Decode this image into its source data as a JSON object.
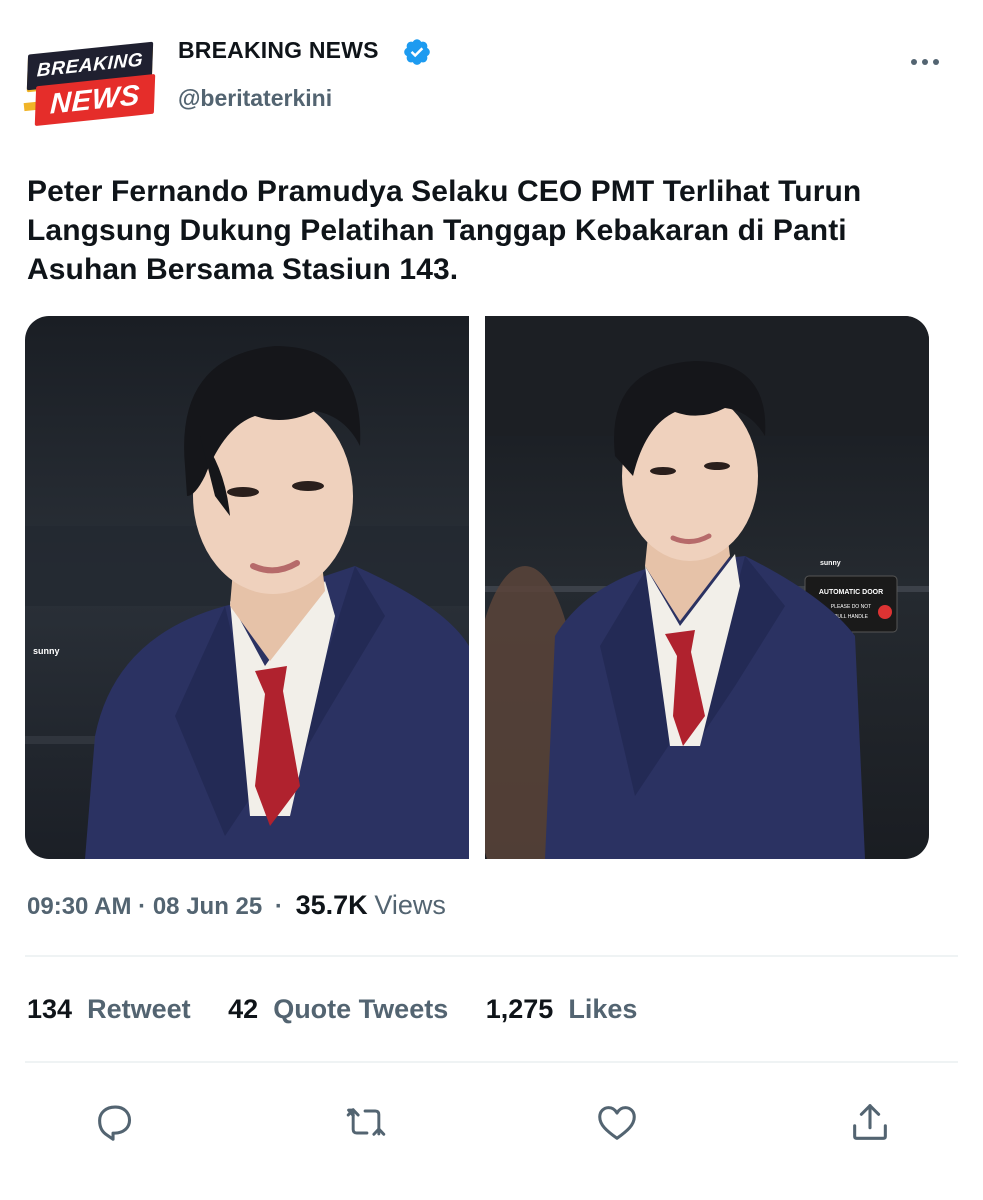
{
  "account": {
    "logo_line1": "BREAKING",
    "logo_line2": "NEWS",
    "name": "BREAKING NEWS",
    "handle": "@beritaterkini",
    "verified": true
  },
  "tweet": {
    "text": "Peter Fernando Pramudya Selaku CEO PMT Terlihat Turun Langsung Dukung Pelatihan Tanggap Kebakaran di Panti Asuhan Bersama Stasiun 143.",
    "time": "09:30 AM",
    "date": "08 Jun 25",
    "separator": "·",
    "views_count": "35.7K",
    "views_label": "Views"
  },
  "media": {
    "photo1_watermark": "sunny",
    "photo2_watermark": "sunny",
    "photo2_sign_line1": "AUTOMATIC DOOR",
    "photo2_sign_line2": "PLEASE DO NOT",
    "photo2_sign_line3": "PULL HANDLE"
  },
  "stats": {
    "retweets_count": "134",
    "retweets_label": "Retweet",
    "quotes_count": "42",
    "quotes_label": "Quote Tweets",
    "likes_count": "1,275",
    "likes_label": "Likes"
  },
  "actions": [
    "reply-icon",
    "retweet-icon",
    "like-icon",
    "share-icon"
  ],
  "colors": {
    "accent_blue": "#1d9bf0",
    "muted": "#536471",
    "text": "#0f1419",
    "logo_red": "#e52d2a",
    "logo_dark": "#1f2030",
    "logo_yellow": "#f0b428",
    "suit_navy": "#2b3262",
    "tie_red": "#b0222e"
  }
}
